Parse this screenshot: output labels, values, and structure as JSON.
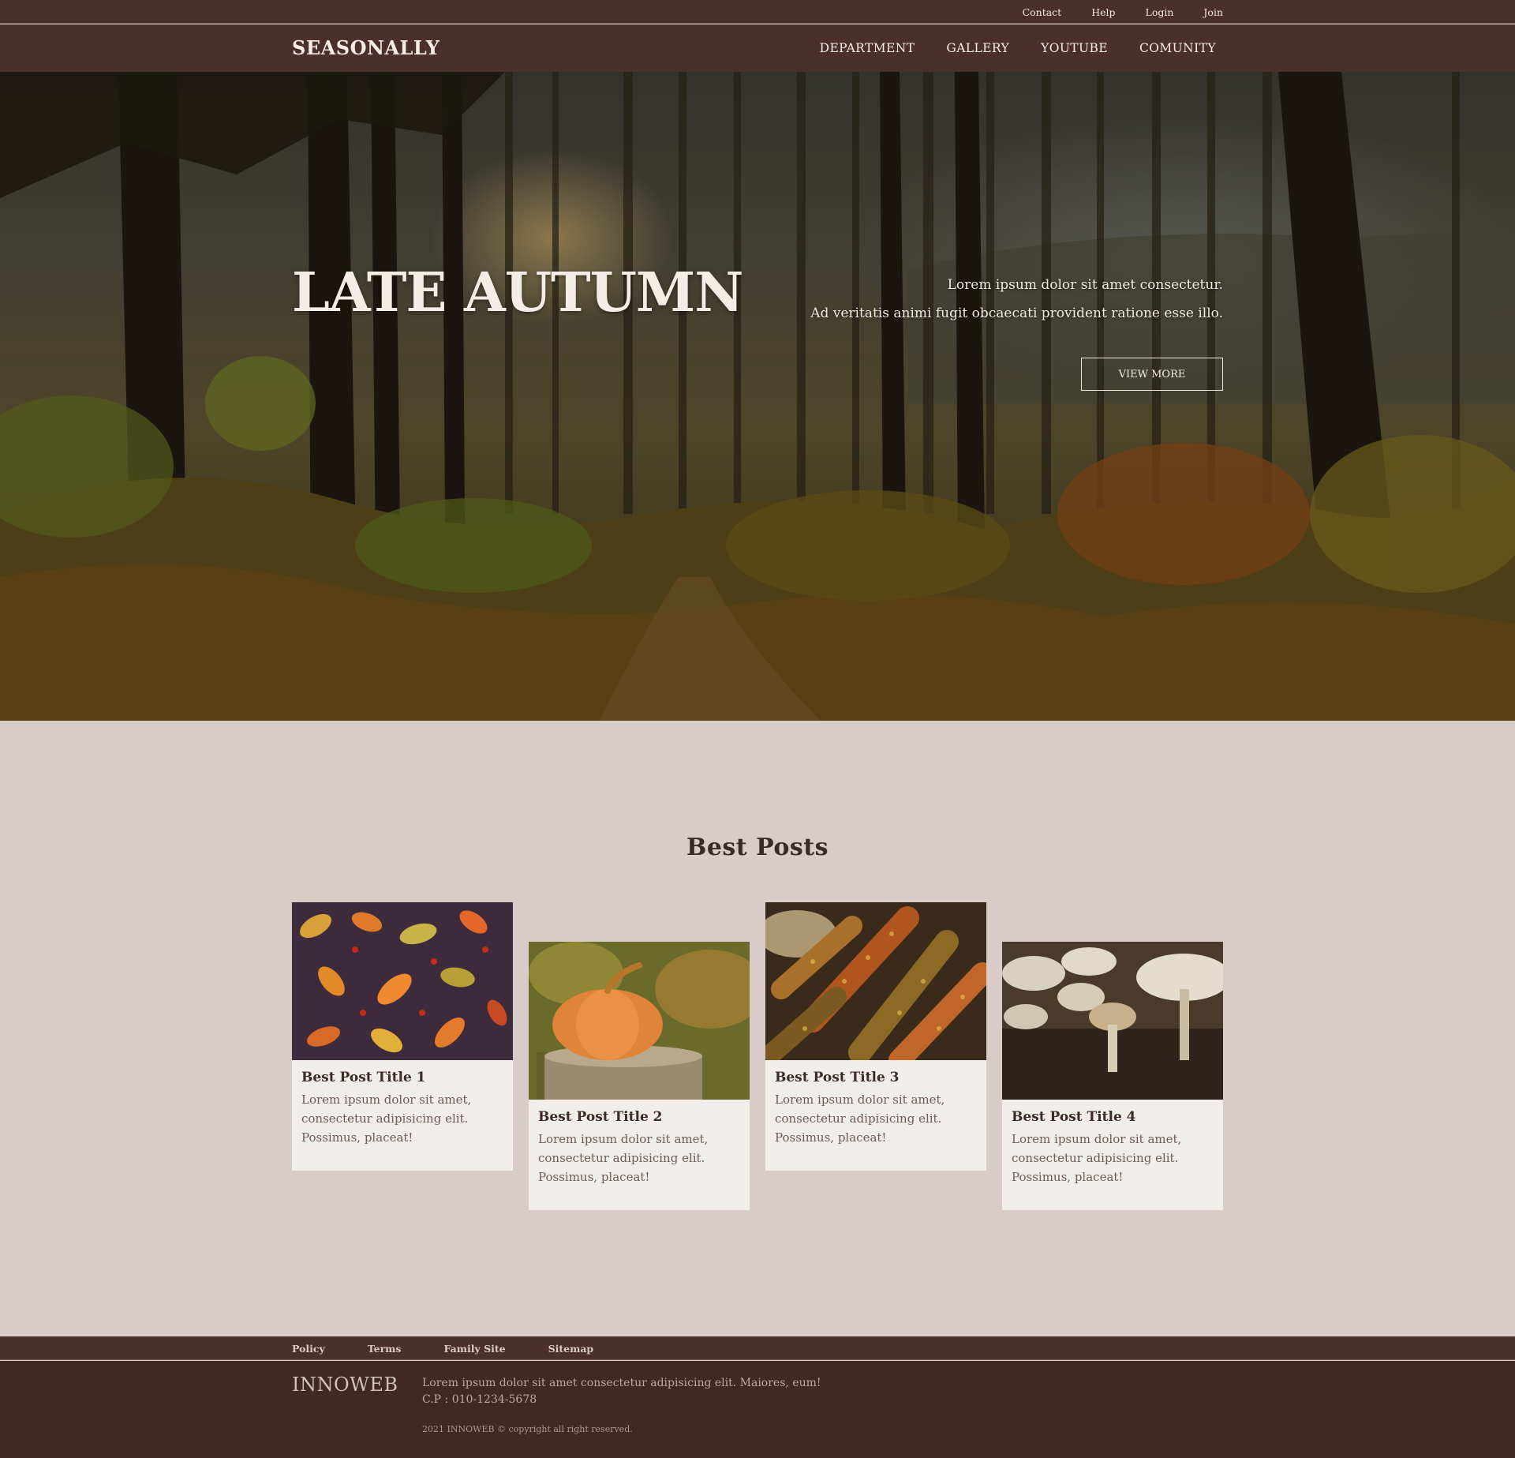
{
  "utility_nav": [
    "Contact",
    "Help",
    "Login",
    "Join"
  ],
  "brand": "SEASONALLY",
  "main_nav": [
    "DEPARTMENT",
    "GALLERY",
    "YOUTUBE",
    "COMUNITY"
  ],
  "hero": {
    "title": "LATE AUTUMN",
    "line1": "Lorem ipsum dolor sit amet consectetur.",
    "line2": "Ad veritatis animi fugit obcaecati provident ratione esse illo.",
    "button": "VIEW MORE"
  },
  "best_posts": {
    "heading": "Best Posts",
    "cards": [
      {
        "title": "Best Post Title 1",
        "desc": "Lorem ipsum dolor sit amet, consectetur adipisicing elit. Possimus, placeat!"
      },
      {
        "title": "Best Post Title 2",
        "desc": "Lorem ipsum dolor sit amet, consectetur adipisicing elit. Possimus, placeat!"
      },
      {
        "title": "Best Post Title 3",
        "desc": "Lorem ipsum dolor sit amet, consectetur adipisicing elit. Possimus, placeat!"
      },
      {
        "title": "Best Post Title 4",
        "desc": "Lorem ipsum dolor sit amet, consectetur adipisicing elit. Possimus, placeat!"
      }
    ]
  },
  "footer": {
    "links": [
      "Policy",
      "Terms",
      "Family Site",
      "Sitemap"
    ],
    "brand": "INNOWEB",
    "info_line1": "Lorem ipsum dolor sit amet consectetur adipisicing elit. Maiores, eum!",
    "info_line2": "C.P : 010-1234-5678",
    "copyright": "2021 INNOWEB © copyright all right reserved."
  },
  "colors": {
    "header_bg": "#4a2f2b",
    "page_bg": "#d8cbc8",
    "card_bg": "#f0edeb",
    "footer_bg": "#3f2825",
    "text_dark": "#3c2a27"
  }
}
